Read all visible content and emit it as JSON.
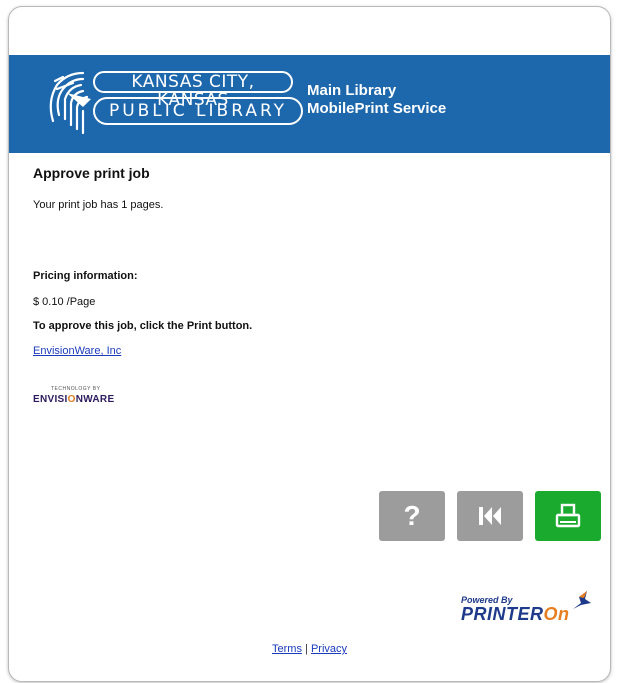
{
  "header": {
    "logo_line1": "KANSAS CITY, KANSAS",
    "logo_line2": "PUBLIC LIBRARY",
    "service_line1": "Main Library",
    "service_line2": "MobilePrint Service",
    "banner_color": "#1d67ad"
  },
  "main": {
    "title": "Approve print job",
    "pages_text": "Your print job has 1 pages.",
    "pricing_heading": "Pricing information:",
    "price_text": "$ 0.10 /Page",
    "approve_text": "To approve this job, click the Print button.",
    "link_text": "EnvisionWare, Inc",
    "tech_by": "TECHNOLOGY BY",
    "ew_brand_pre": "ENVISI",
    "ew_brand_o": "O",
    "ew_brand_post": "NWARE"
  },
  "actions": {
    "help_label": "?",
    "help_icon": "question-icon",
    "back_icon": "rewind-icon",
    "print_icon": "printer-icon",
    "button_gray": "#9c9c9c",
    "button_green": "#1aab2e"
  },
  "powered": {
    "small": "Powered By",
    "brand_pre": "PRINTER",
    "brand_on": "On"
  },
  "footer": {
    "terms": "Terms",
    "separator": "|",
    "privacy": "Privacy"
  }
}
